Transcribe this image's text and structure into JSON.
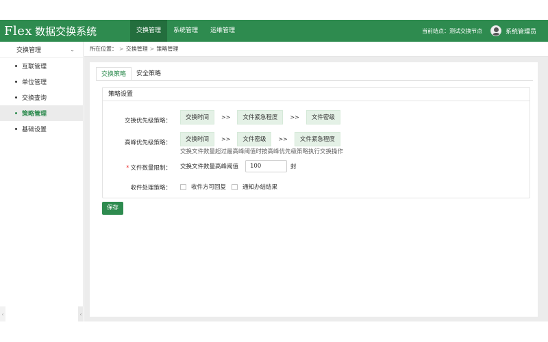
{
  "app": {
    "logo_mark": "Flex",
    "title": "数据交换系统"
  },
  "nav": [
    {
      "label": "交换管理",
      "active": true
    },
    {
      "label": "系统管理",
      "active": false
    },
    {
      "label": "运维管理",
      "active": false
    }
  ],
  "header_right": {
    "node": "当前结点：测试交换节点",
    "user": "系统管理员"
  },
  "sidebar": {
    "section": "交换管理",
    "items": [
      {
        "label": "互联管理"
      },
      {
        "label": "单位管理"
      },
      {
        "label": "交换查询"
      },
      {
        "label": "策略管理"
      },
      {
        "label": "基础设置"
      }
    ],
    "active_index": 3
  },
  "breadcrumb": {
    "prefix": "所在位置：",
    "sep": ">",
    "level1": "交换管理",
    "level2": "策略管理"
  },
  "tabs": [
    {
      "label": "交换策略"
    },
    {
      "label": "安全策略"
    }
  ],
  "card": {
    "title": "策略设置",
    "exchange_priority": {
      "label": "交换优先级策略：",
      "order": [
        "交换时间",
        "文件紧急程度",
        "文件密级"
      ]
    },
    "peak_priority": {
      "label": "高峰优先级策略：",
      "order": [
        "交换时间",
        "文件密级",
        "文件紧急程度"
      ],
      "hint": "交换文件数量超过最高峰阈值时按高峰优先级策略执行交换操作"
    },
    "file_limit": {
      "required_mark": "*",
      "label": "文件数量限制：",
      "sub_label": "交换文件数量高峰阈值",
      "value": "100",
      "unit": "封"
    },
    "receive_strategy": {
      "label": "收件处理策略：",
      "options": [
        {
          "label": "收件方可回复",
          "checked": false
        },
        {
          "label": "通知办结结果",
          "checked": false
        }
      ]
    },
    "arrow": ">>"
  },
  "save_label": "保存",
  "colors": {
    "brand": "#2e8b4f",
    "chip_bg": "#e4f1e6"
  }
}
